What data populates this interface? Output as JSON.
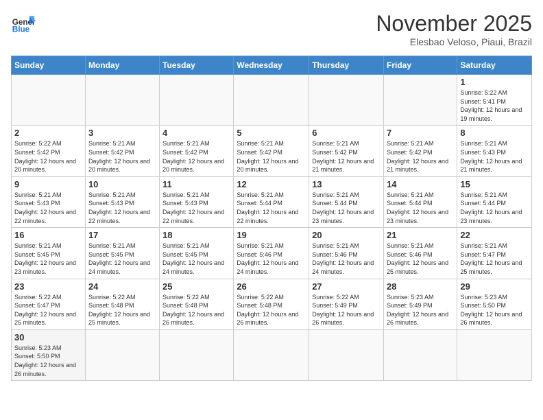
{
  "header": {
    "logo_general": "General",
    "logo_blue": "Blue",
    "month_title": "November 2025",
    "location": "Elesbao Veloso, Piaui, Brazil"
  },
  "weekdays": [
    "Sunday",
    "Monday",
    "Tuesday",
    "Wednesday",
    "Thursday",
    "Friday",
    "Saturday"
  ],
  "weeks": [
    [
      {
        "day": "",
        "info": ""
      },
      {
        "day": "",
        "info": ""
      },
      {
        "day": "",
        "info": ""
      },
      {
        "day": "",
        "info": ""
      },
      {
        "day": "",
        "info": ""
      },
      {
        "day": "",
        "info": ""
      },
      {
        "day": "1",
        "info": "Sunrise: 5:22 AM\nSunset: 5:41 PM\nDaylight: 12 hours and 19 minutes."
      }
    ],
    [
      {
        "day": "2",
        "info": "Sunrise: 5:22 AM\nSunset: 5:42 PM\nDaylight: 12 hours and 20 minutes."
      },
      {
        "day": "3",
        "info": "Sunrise: 5:21 AM\nSunset: 5:42 PM\nDaylight: 12 hours and 20 minutes."
      },
      {
        "day": "4",
        "info": "Sunrise: 5:21 AM\nSunset: 5:42 PM\nDaylight: 12 hours and 20 minutes."
      },
      {
        "day": "5",
        "info": "Sunrise: 5:21 AM\nSunset: 5:42 PM\nDaylight: 12 hours and 20 minutes."
      },
      {
        "day": "6",
        "info": "Sunrise: 5:21 AM\nSunset: 5:42 PM\nDaylight: 12 hours and 21 minutes."
      },
      {
        "day": "7",
        "info": "Sunrise: 5:21 AM\nSunset: 5:42 PM\nDaylight: 12 hours and 21 minutes."
      },
      {
        "day": "8",
        "info": "Sunrise: 5:21 AM\nSunset: 5:43 PM\nDaylight: 12 hours and 21 minutes."
      }
    ],
    [
      {
        "day": "9",
        "info": "Sunrise: 5:21 AM\nSunset: 5:43 PM\nDaylight: 12 hours and 22 minutes."
      },
      {
        "day": "10",
        "info": "Sunrise: 5:21 AM\nSunset: 5:43 PM\nDaylight: 12 hours and 22 minutes."
      },
      {
        "day": "11",
        "info": "Sunrise: 5:21 AM\nSunset: 5:43 PM\nDaylight: 12 hours and 22 minutes."
      },
      {
        "day": "12",
        "info": "Sunrise: 5:21 AM\nSunset: 5:44 PM\nDaylight: 12 hours and 22 minutes."
      },
      {
        "day": "13",
        "info": "Sunrise: 5:21 AM\nSunset: 5:44 PM\nDaylight: 12 hours and 23 minutes."
      },
      {
        "day": "14",
        "info": "Sunrise: 5:21 AM\nSunset: 5:44 PM\nDaylight: 12 hours and 23 minutes."
      },
      {
        "day": "15",
        "info": "Sunrise: 5:21 AM\nSunset: 5:44 PM\nDaylight: 12 hours and 23 minutes."
      }
    ],
    [
      {
        "day": "16",
        "info": "Sunrise: 5:21 AM\nSunset: 5:45 PM\nDaylight: 12 hours and 23 minutes."
      },
      {
        "day": "17",
        "info": "Sunrise: 5:21 AM\nSunset: 5:45 PM\nDaylight: 12 hours and 24 minutes."
      },
      {
        "day": "18",
        "info": "Sunrise: 5:21 AM\nSunset: 5:45 PM\nDaylight: 12 hours and 24 minutes."
      },
      {
        "day": "19",
        "info": "Sunrise: 5:21 AM\nSunset: 5:46 PM\nDaylight: 12 hours and 24 minutes."
      },
      {
        "day": "20",
        "info": "Sunrise: 5:21 AM\nSunset: 5:46 PM\nDaylight: 12 hours and 24 minutes."
      },
      {
        "day": "21",
        "info": "Sunrise: 5:21 AM\nSunset: 5:46 PM\nDaylight: 12 hours and 25 minutes."
      },
      {
        "day": "22",
        "info": "Sunrise: 5:21 AM\nSunset: 5:47 PM\nDaylight: 12 hours and 25 minutes."
      }
    ],
    [
      {
        "day": "23",
        "info": "Sunrise: 5:22 AM\nSunset: 5:47 PM\nDaylight: 12 hours and 25 minutes."
      },
      {
        "day": "24",
        "info": "Sunrise: 5:22 AM\nSunset: 5:48 PM\nDaylight: 12 hours and 25 minutes."
      },
      {
        "day": "25",
        "info": "Sunrise: 5:22 AM\nSunset: 5:48 PM\nDaylight: 12 hours and 26 minutes."
      },
      {
        "day": "26",
        "info": "Sunrise: 5:22 AM\nSunset: 5:48 PM\nDaylight: 12 hours and 26 minutes."
      },
      {
        "day": "27",
        "info": "Sunrise: 5:22 AM\nSunset: 5:49 PM\nDaylight: 12 hours and 26 minutes."
      },
      {
        "day": "28",
        "info": "Sunrise: 5:23 AM\nSunset: 5:49 PM\nDaylight: 12 hours and 26 minutes."
      },
      {
        "day": "29",
        "info": "Sunrise: 5:23 AM\nSunset: 5:50 PM\nDaylight: 12 hours and 26 minutes."
      }
    ],
    [
      {
        "day": "30",
        "info": "Sunrise: 5:23 AM\nSunset: 5:50 PM\nDaylight: 12 hours and 26 minutes."
      },
      {
        "day": "",
        "info": ""
      },
      {
        "day": "",
        "info": ""
      },
      {
        "day": "",
        "info": ""
      },
      {
        "day": "",
        "info": ""
      },
      {
        "day": "",
        "info": ""
      },
      {
        "day": "",
        "info": ""
      }
    ]
  ]
}
